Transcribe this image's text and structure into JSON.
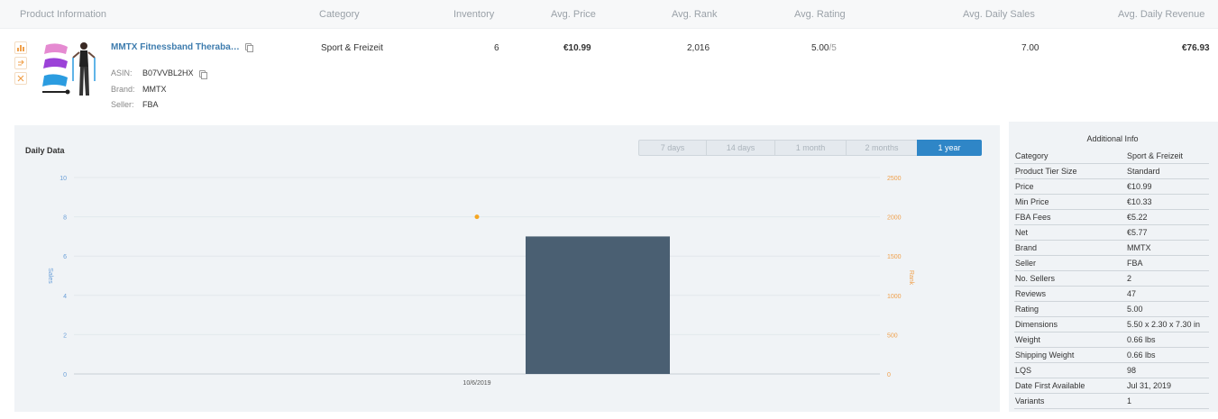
{
  "header": {
    "product_info": "Product Information",
    "category": "Category",
    "inventory": "Inventory",
    "avg_price": "Avg. Price",
    "avg_rank": "Avg. Rank",
    "avg_rating": "Avg. Rating",
    "avg_daily_sales": "Avg. Daily Sales",
    "avg_daily_revenue": "Avg. Daily Revenue"
  },
  "product": {
    "title": "MMTX Fitnessband Theraba…",
    "asin_label": "ASIN:",
    "asin": "B07VVBL2HX",
    "brand_label": "Brand:",
    "brand": "MMTX",
    "seller_label": "Seller:",
    "seller": "FBA",
    "category": "Sport & Freizeit",
    "inventory": "6",
    "avg_price": "€10.99",
    "avg_rank": "2,016",
    "avg_rating": "5.00",
    "avg_rating_max": "/5",
    "avg_daily_sales": "7.00",
    "avg_daily_revenue": "€76.93",
    "icons": [
      "bar-chart-icon",
      "refresh-icon",
      "close-icon"
    ]
  },
  "chart": {
    "label": "Daily Data",
    "ranges": [
      "7 days",
      "14 days",
      "1 month",
      "2 months",
      "1 year"
    ],
    "active_range": "1 year"
  },
  "chart_data": {
    "type": "bar",
    "categories": [
      "10/6/2019"
    ],
    "series": [
      {
        "type": "bar",
        "values": [
          7
        ],
        "color": "#4a5f72"
      },
      {
        "type": "scatter",
        "values": [
          2000
        ],
        "color": "#f5a623"
      }
    ],
    "xlabel": "",
    "ylabel": "Sales",
    "ylabel_right": "Rank",
    "ylim": [
      0,
      10
    ],
    "ylim_right": [
      0,
      2500
    ],
    "yticks": [
      "0",
      "2",
      "4",
      "6",
      "8",
      "10"
    ],
    "yticks_right": [
      "0",
      "500",
      "1000",
      "1500",
      "2000",
      "2500"
    ],
    "xtick_labels": [
      "10/6/2019"
    ],
    "colors": {
      "left_axis": "#6a9fd8",
      "right_axis": "#f0a04b"
    }
  },
  "info": {
    "title": "Additional Info",
    "rows": [
      {
        "k": "Category",
        "v": "Sport & Freizeit"
      },
      {
        "k": "Product Tier Size",
        "v": "Standard"
      },
      {
        "k": "Price",
        "v": "€10.99"
      },
      {
        "k": "Min Price",
        "v": "€10.33"
      },
      {
        "k": "FBA Fees",
        "v": "€5.22"
      },
      {
        "k": "Net",
        "v": "€5.77"
      },
      {
        "k": "Brand",
        "v": "MMTX"
      },
      {
        "k": "Seller",
        "v": "FBA"
      },
      {
        "k": "No. Sellers",
        "v": "2"
      },
      {
        "k": "Reviews",
        "v": "47"
      },
      {
        "k": "Rating",
        "v": "5.00"
      },
      {
        "k": "Dimensions",
        "v": "5.50 x 2.30 x 7.30 in"
      },
      {
        "k": "Weight",
        "v": "0.66 lbs"
      },
      {
        "k": "Shipping Weight",
        "v": "0.66 lbs"
      },
      {
        "k": "LQS",
        "v": "98"
      },
      {
        "k": "Date First Available",
        "v": "Jul 31, 2019"
      },
      {
        "k": "Variants",
        "v": "1"
      }
    ]
  }
}
